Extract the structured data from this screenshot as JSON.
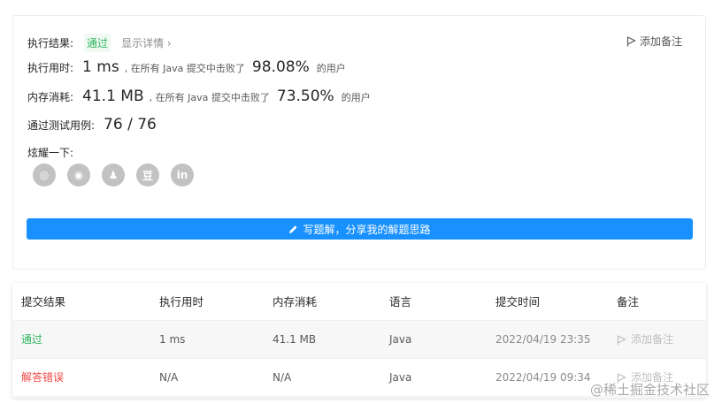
{
  "result": {
    "status_label": "执行结果:",
    "status_value": "通过",
    "detail_link": "显示详情 ›",
    "note_button": "添加备注",
    "runtime_label": "执行用时:",
    "runtime_value": "1 ms",
    "runtime_beat_text": ", 在所有 Java 提交中击败了",
    "runtime_percent": "98.08%",
    "runtime_users": "的用户",
    "memory_label": "内存消耗:",
    "memory_value": "41.1 MB",
    "memory_beat_text": ", 在所有 Java 提交中击败了",
    "memory_percent": "73.50%",
    "memory_users": "的用户",
    "tests_label": "通过测试用例:",
    "tests_value": "76 / 76",
    "share_label": "炫耀一下:",
    "share_icons": [
      "wechat-icon",
      "weibo-icon",
      "qq-icon",
      "douban-icon",
      "linkedin-icon"
    ],
    "share_glyphs": [
      "◎",
      "◉",
      "♟",
      "豆",
      "in"
    ],
    "solution_button": "写题解，分享我的解题思路"
  },
  "table": {
    "headers": [
      "提交结果",
      "执行用时",
      "内存消耗",
      "语言",
      "提交时间",
      "备注"
    ],
    "rows": [
      {
        "result": "通过",
        "runtime": "1 ms",
        "memory": "41.1 MB",
        "language": "Java",
        "time": "2022/04/19 23:35",
        "note": "添加备注"
      },
      {
        "result": "解答错误",
        "runtime": "N/A",
        "memory": "N/A",
        "language": "Java",
        "time": "2022/04/19 09:34",
        "note": "添加备注"
      }
    ]
  },
  "watermark": "@稀土掘金技术社区",
  "colors": {
    "accent": "#1890ff",
    "pass": "#2db55d",
    "fail": "#ef4743"
  }
}
